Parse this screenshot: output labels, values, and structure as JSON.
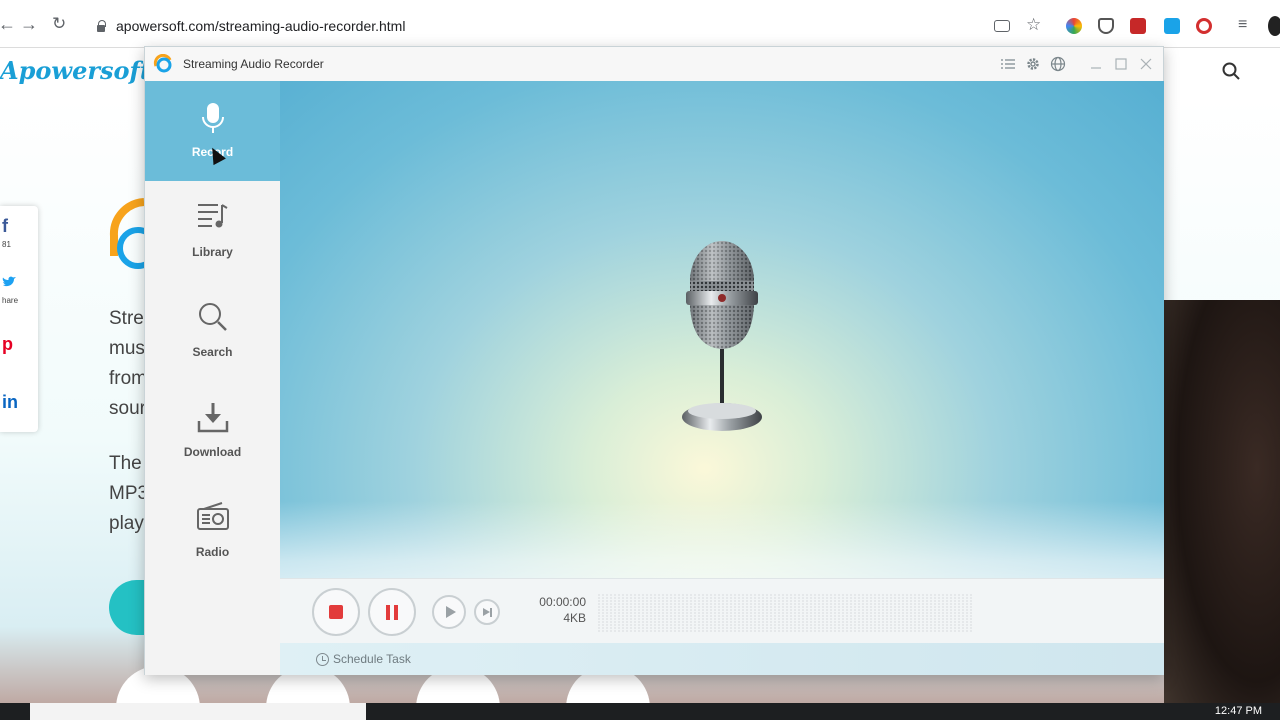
{
  "browser": {
    "url": "apowersoft.com/streaming-audio-recorder.html"
  },
  "website": {
    "logo": "Apowersoft",
    "social": [
      {
        "icon": "facebook-icon",
        "label": "f",
        "count": "81"
      },
      {
        "icon": "twitter-icon",
        "label": "",
        "count": "hare"
      },
      {
        "icon": "pinterest-icon",
        "label": "p",
        "count": ""
      },
      {
        "icon": "linkedin-icon",
        "label": "in",
        "count": ""
      }
    ],
    "paragraph1": [
      "Stre",
      "mus",
      "from",
      "sour"
    ],
    "paragraph2": [
      "The",
      "MP3",
      "play"
    ]
  },
  "app": {
    "title": "Streaming Audio Recorder",
    "accent_color": "#6bbcd9",
    "record_color": "#e23b3b",
    "sidebar": [
      {
        "label": "Record",
        "icon": "microphone-icon",
        "active": true
      },
      {
        "label": "Library",
        "icon": "music-list-icon",
        "active": false
      },
      {
        "label": "Search",
        "icon": "search-icon",
        "active": false
      },
      {
        "label": "Download",
        "icon": "download-icon",
        "active": false
      },
      {
        "label": "Radio",
        "icon": "radio-icon",
        "active": false
      }
    ],
    "player": {
      "time": "00:00:00",
      "size": "4KB"
    },
    "status": {
      "schedule_label": "Schedule Task"
    }
  },
  "taskbar": {
    "clock": "12:47 PM"
  }
}
